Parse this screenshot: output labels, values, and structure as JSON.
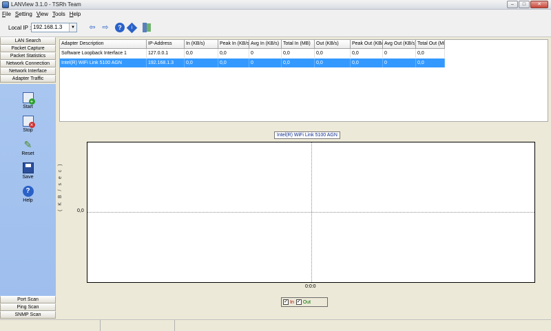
{
  "window": {
    "title": "LANView 3.1.0 - TSRh Team"
  },
  "menu": [
    {
      "label": "File",
      "key": "F",
      "rest": "ile"
    },
    {
      "label": "Setting",
      "key": "S",
      "rest": "etting"
    },
    {
      "label": "View",
      "key": "V",
      "rest": "iew"
    },
    {
      "label": "Tools",
      "key": "T",
      "rest": "ools"
    },
    {
      "label": "Help",
      "key": "H",
      "rest": "elp"
    }
  ],
  "toolbar": {
    "local_ip_label": "Local IP :",
    "local_ip_value": "192.168.1.3"
  },
  "sidebar": {
    "top_items": [
      "LAN Search",
      "Packet Capture",
      "Packet Statistics",
      "Network Connection",
      "Network Interface",
      "Adapter Traffic"
    ],
    "actions": [
      "Start",
      "Stop",
      "Reset",
      "Save",
      "Help"
    ],
    "bottom_items": [
      "Port Scan",
      "Ping Scan",
      "SNMP Scan"
    ]
  },
  "table": {
    "columns": [
      "Adapter Description",
      "IP-Address",
      "In (KB/s)",
      "Peak In (KB/s)",
      "Avg In (KB/s)",
      "Total In (MB)",
      "Out (KB/s)",
      "Peak Out (KB/s)",
      "Avg Out (KB/s)",
      "Total Out (MB)"
    ],
    "rows": [
      [
        "Software Loopback Interface 1",
        "127.0.0.1",
        "0,0",
        "0,0",
        "0",
        "0,0",
        "0,0",
        "0,0",
        "0",
        "0,0"
      ],
      [
        "Intel(R) WiFi Link 5100 AGN",
        "192.168.1.3",
        "0,0",
        "0,0",
        "0",
        "0,0",
        "0,0",
        "0,0",
        "0",
        "0,0"
      ]
    ],
    "selected_row": 1
  },
  "chart_data": {
    "type": "line",
    "title": "Intel(R) WiFi Link 5100 AGN",
    "ylabel": "( K B / s e c )",
    "y_tick": "0,0",
    "x_tick": "0:0:0",
    "series": [
      {
        "name": "In",
        "values": [],
        "color": "#b00000",
        "checked": true
      },
      {
        "name": "Out",
        "values": [],
        "color": "#007000",
        "checked": true
      }
    ],
    "grid": true
  },
  "colors": {
    "selection": "#3399ff",
    "sidebar_panel": "#a8c6ef"
  }
}
